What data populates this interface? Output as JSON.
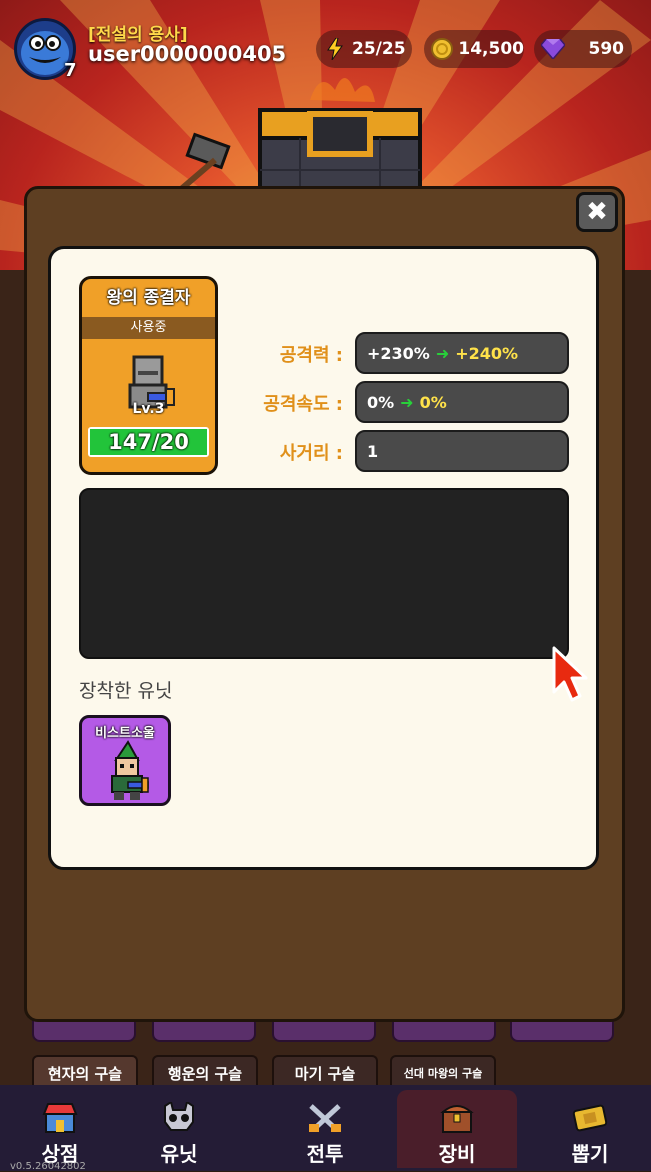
{
  "header": {
    "level": "7",
    "title": "[전설의 용사]",
    "username": "user0000000405",
    "energy": "25/25",
    "coins": "14,500",
    "gems": "590"
  },
  "modal": {
    "close_icon": "close-icon",
    "equipment": {
      "name": "왕의 종결자",
      "status": "사용중",
      "level": "Lv.3",
      "progress_text": "147/20",
      "progress_fraction": 1.0
    },
    "stats": [
      {
        "label": "공격력 :",
        "current": "+230%",
        "next": "+240%"
      },
      {
        "label": "공격속도 :",
        "current": "0%",
        "next": "0%"
      },
      {
        "label": "사거리 :",
        "current": "1",
        "next": ""
      }
    ],
    "equipped_units_label": "장착한 유닛",
    "equipped_unit": {
      "name": "비스트소울"
    }
  },
  "background_chips": [
    "현자의 구슬",
    "행운의 구슬",
    "마기 구슬",
    "선대 마왕의 구슬"
  ],
  "bottom_nav": [
    {
      "label": "상점",
      "icon": "shop-icon"
    },
    {
      "label": "유닛",
      "icon": "skull-icon"
    },
    {
      "label": "전투",
      "icon": "crossed-swords-icon"
    },
    {
      "label": "장비",
      "icon": "chest-icon",
      "active": true
    },
    {
      "label": "뽑기",
      "icon": "ticket-icon"
    }
  ],
  "version": "v0.5.26042802",
  "colors": {
    "accent_orange": "#f0a028",
    "stat_label": "#e0901a",
    "arrow_green": "#28d03a",
    "value_yellow": "#ffe24a",
    "unit_purple": "#b45ae6"
  }
}
